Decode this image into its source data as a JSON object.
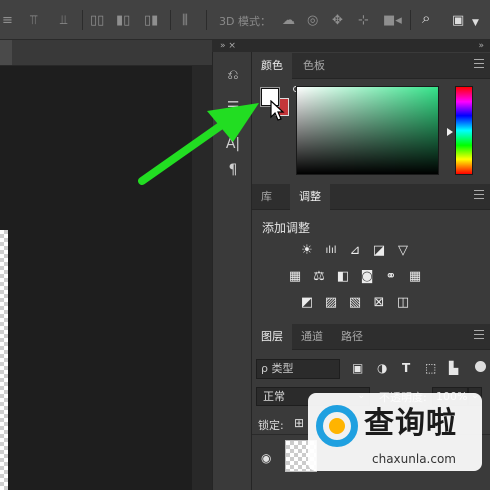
{
  "options_bar": {
    "mode_3d_label": "3D 模式："
  },
  "panel_strip": {
    "collapse_label": "» ×"
  },
  "color_panel": {
    "tabs": [
      {
        "label": "颜色",
        "active": true
      },
      {
        "label": "色板",
        "active": false
      }
    ],
    "foreground_color": "#ffffff",
    "background_color": "#c3363a",
    "picker_hue_color": "#35e48a"
  },
  "adjustments_panel": {
    "tabs": [
      {
        "label": "库",
        "active": false
      },
      {
        "label": "调整",
        "active": true
      }
    ],
    "title": "添加调整"
  },
  "layers_panel": {
    "tabs": [
      {
        "label": "图层",
        "active": true
      },
      {
        "label": "通道",
        "active": false
      },
      {
        "label": "路径",
        "active": false
      }
    ],
    "filter_label": "ρ 类型",
    "blend_mode": "正常",
    "opacity_label": "不透明度:",
    "opacity_value": "100%",
    "lock_label": "锁定:"
  },
  "watermark": {
    "title": "查询啦",
    "url": "chaxunla.com"
  },
  "colors": {
    "accent_arrow": "#22dd22",
    "watermark_blue": "#1fa0e0",
    "watermark_orange": "#ffb400"
  }
}
